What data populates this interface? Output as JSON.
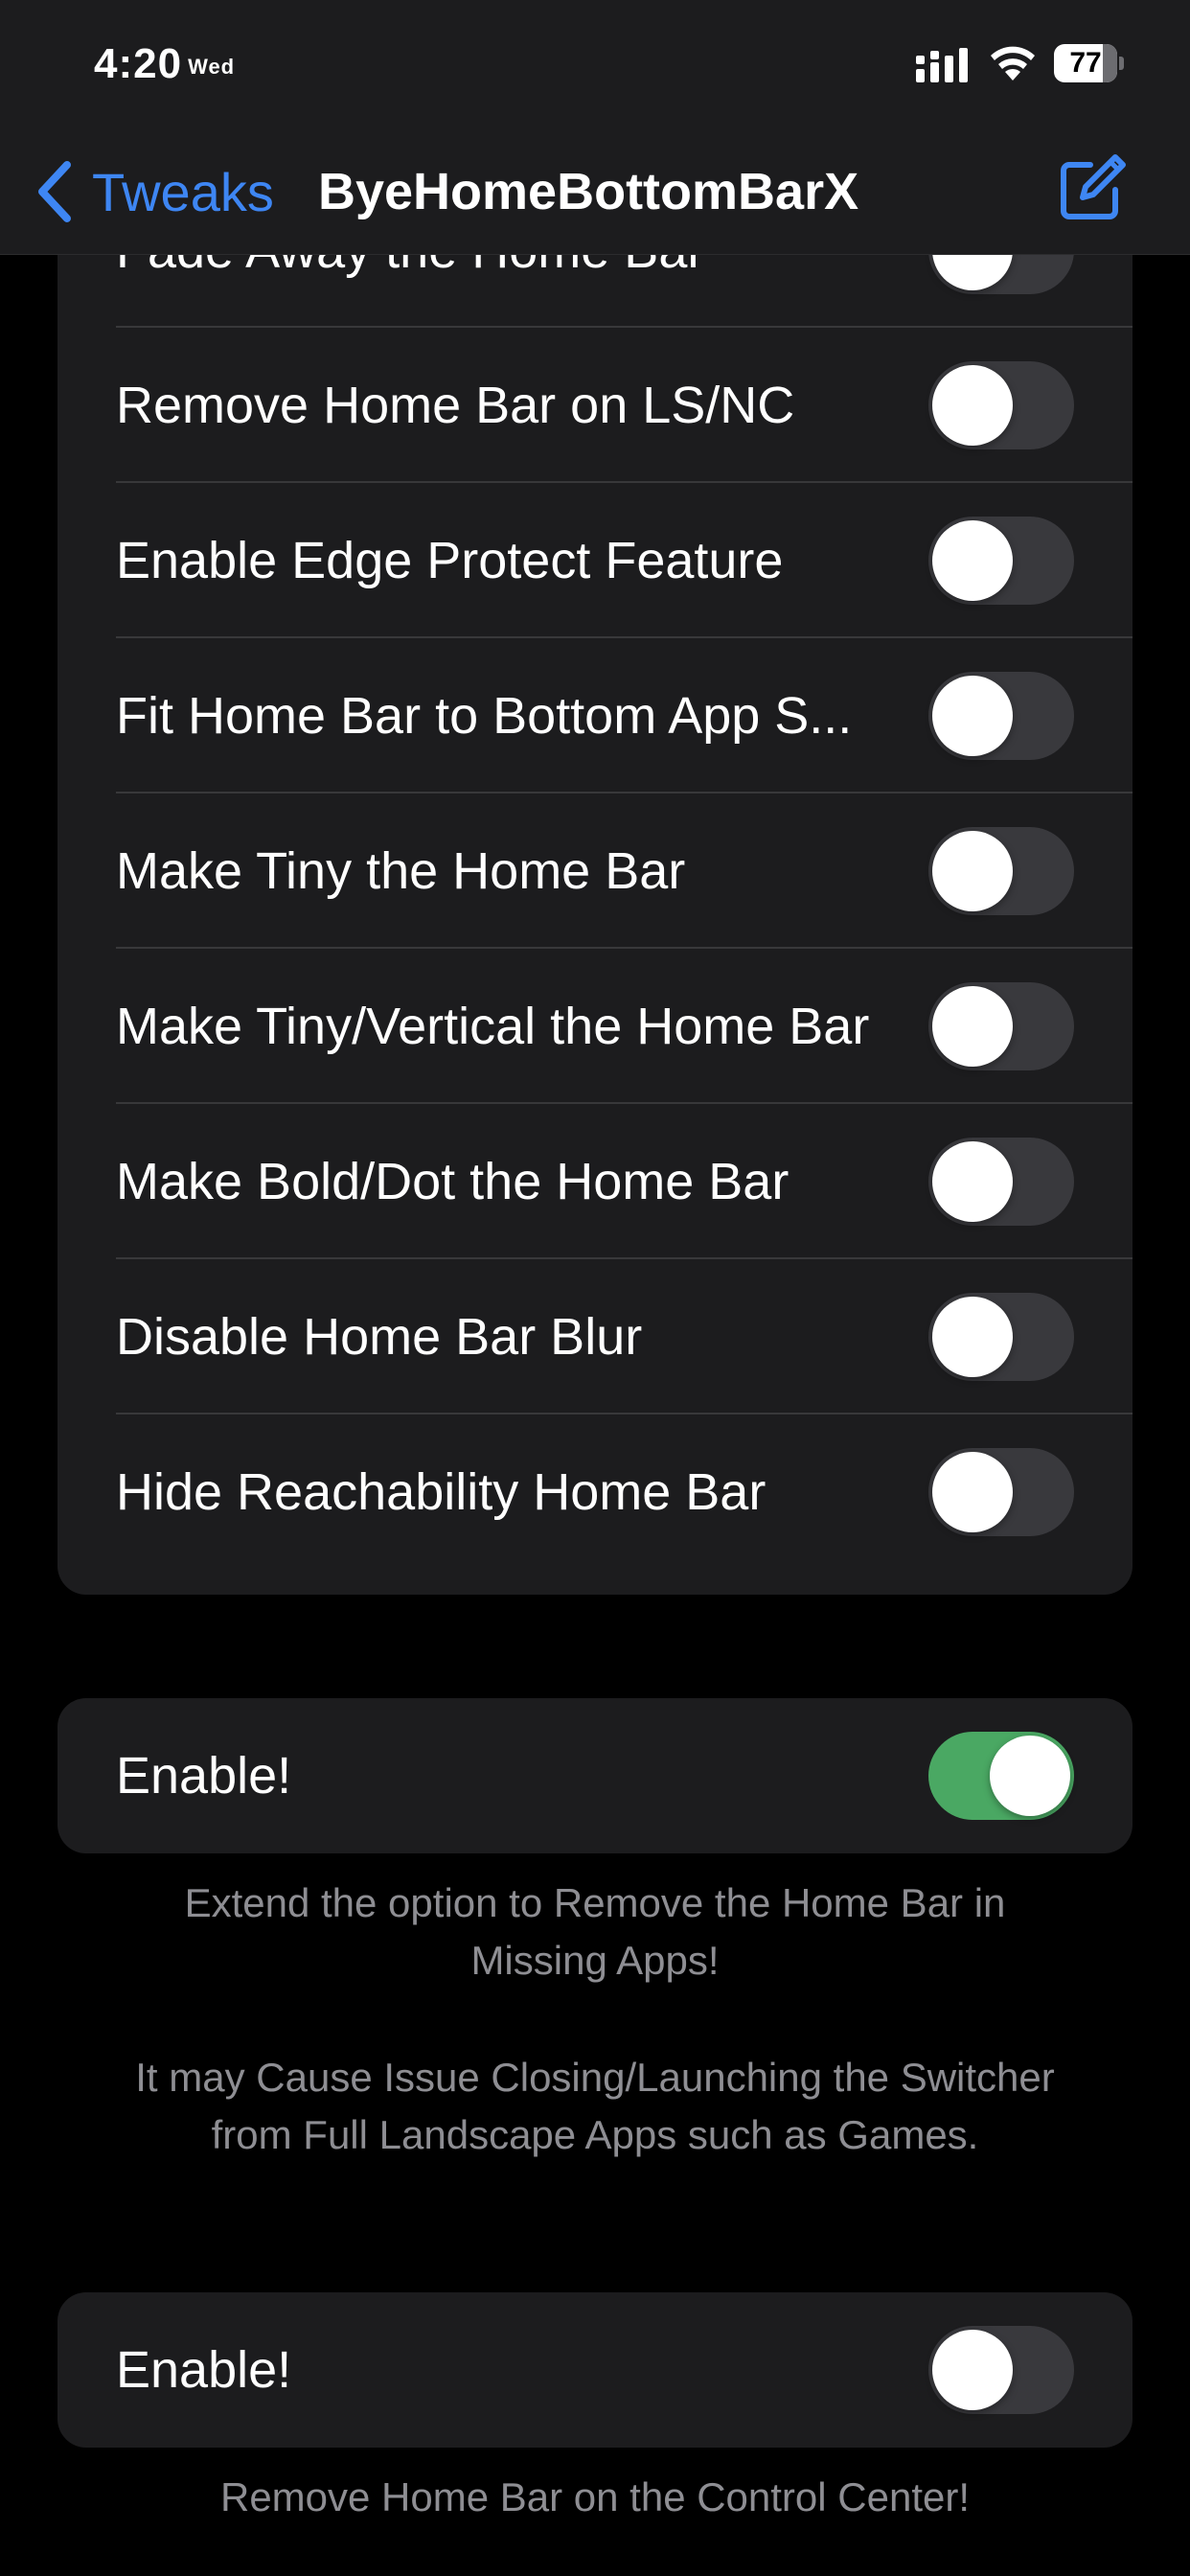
{
  "status_bar": {
    "time": "4:20",
    "day": "Wed",
    "battery": "77",
    "battery_level": 0.77
  },
  "nav": {
    "back_label": "Tweaks",
    "title": "ByeHomeBottomBarX"
  },
  "main_group": {
    "rows": [
      {
        "label": "Fade Away the Home Bar",
        "on": false
      },
      {
        "label": "Remove Home Bar on LS/NC",
        "on": false
      },
      {
        "label": "Enable Edge Protect Feature",
        "on": false
      },
      {
        "label": "Fit Home Bar to Bottom App S...",
        "on": false
      },
      {
        "label": "Make Tiny the Home Bar",
        "on": false
      },
      {
        "label": "Make Tiny/Vertical the Home Bar",
        "on": false
      },
      {
        "label": "Make Bold/Dot the Home Bar",
        "on": false
      },
      {
        "label": "Disable Home Bar Blur",
        "on": false
      },
      {
        "label": "Hide Reachability Home Bar",
        "on": false
      }
    ]
  },
  "missing_apps_group": {
    "label": "Enable!",
    "on": true,
    "footer": [
      "Extend the option to Remove the Home Bar in Missing Apps!",
      "It may Cause Issue Closing/Launching the Switcher from Full Landscape Apps such as Games."
    ]
  },
  "control_center_group": {
    "label": "Enable!",
    "on": false,
    "footer": "Remove Home Bar on the Control Center!"
  },
  "colors": {
    "accent": "#3e86f3",
    "toggle_on": "#4aa863",
    "toggle_off": "#39393d",
    "cell_background": "#1c1c1e",
    "footer_text": "#8e8e93"
  },
  "icons": {
    "back": "chevron-left-icon",
    "compose": "square-and-pencil-icon",
    "signal": "cellular-signal-icon",
    "wifi": "wifi-icon",
    "battery": "battery-icon"
  }
}
